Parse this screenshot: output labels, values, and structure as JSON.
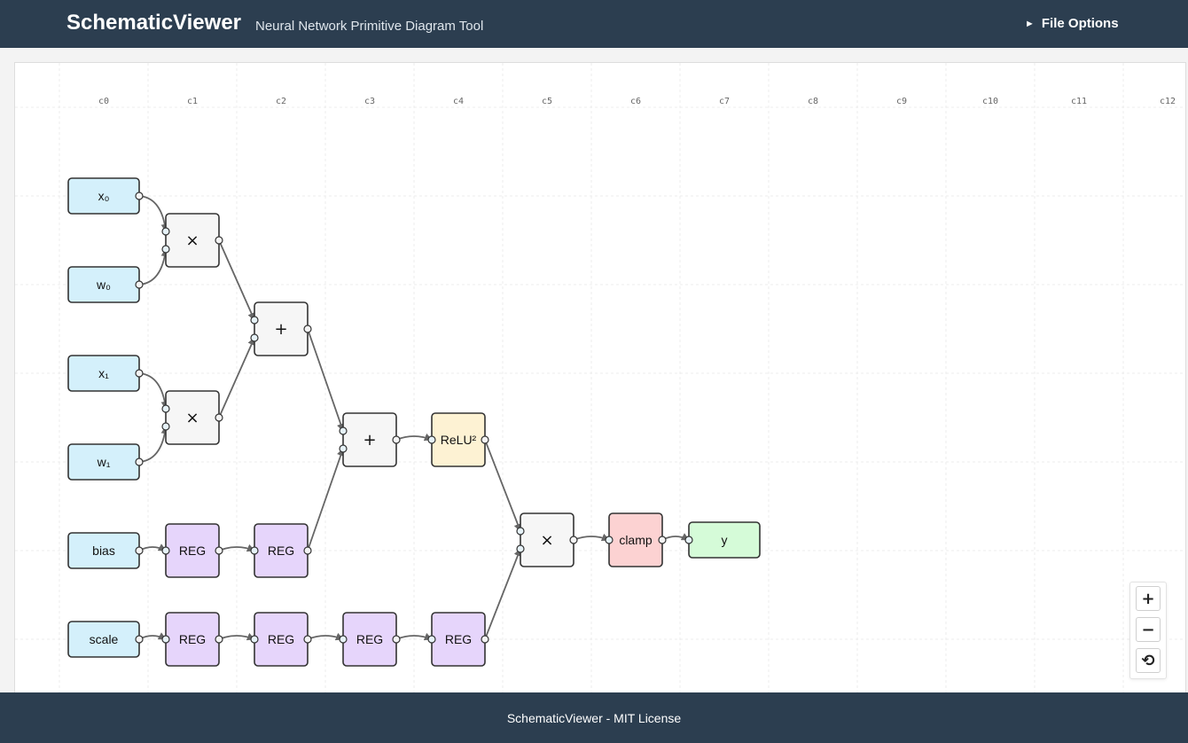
{
  "header": {
    "title": "SchematicViewer",
    "subtitle": "Neural Network Primitive Diagram Tool",
    "file_options": "File Options"
  },
  "columns": [
    "c0",
    "c1",
    "c2",
    "c3",
    "c4",
    "c5",
    "c6",
    "c7",
    "c8",
    "c9",
    "c10",
    "c11",
    "c12"
  ],
  "nodes": [
    {
      "id": "x0",
      "label": "x₀",
      "kind": "input"
    },
    {
      "id": "w0",
      "label": "w₀",
      "kind": "input"
    },
    {
      "id": "x1",
      "label": "x₁",
      "kind": "input"
    },
    {
      "id": "w1",
      "label": "w₁",
      "kind": "input"
    },
    {
      "id": "bias",
      "label": "bias",
      "kind": "input"
    },
    {
      "id": "scale",
      "label": "scale",
      "kind": "input"
    },
    {
      "id": "mul0",
      "label": "×",
      "kind": "op"
    },
    {
      "id": "mul1",
      "label": "×",
      "kind": "op"
    },
    {
      "id": "add0",
      "label": "+",
      "kind": "op"
    },
    {
      "id": "add1",
      "label": "+",
      "kind": "op"
    },
    {
      "id": "relu",
      "label": "ReLU²",
      "kind": "activation"
    },
    {
      "id": "mul2",
      "label": "×",
      "kind": "op"
    },
    {
      "id": "clamp",
      "label": "clamp",
      "kind": "clamp"
    },
    {
      "id": "y",
      "label": "y",
      "kind": "output"
    },
    {
      "id": "regb1",
      "label": "REG",
      "kind": "reg"
    },
    {
      "id": "regb2",
      "label": "REG",
      "kind": "reg"
    },
    {
      "id": "regs1",
      "label": "REG",
      "kind": "reg"
    },
    {
      "id": "regs2",
      "label": "REG",
      "kind": "reg"
    },
    {
      "id": "regs3",
      "label": "REG",
      "kind": "reg"
    },
    {
      "id": "regs4",
      "label": "REG",
      "kind": "reg"
    }
  ],
  "edges": [
    {
      "from": "x0",
      "to": "mul0",
      "port": 0
    },
    {
      "from": "w0",
      "to": "mul0",
      "port": 1
    },
    {
      "from": "x1",
      "to": "mul1",
      "port": 0
    },
    {
      "from": "w1",
      "to": "mul1",
      "port": 1
    },
    {
      "from": "mul0",
      "to": "add0",
      "port": 0
    },
    {
      "from": "mul1",
      "to": "add0",
      "port": 1
    },
    {
      "from": "bias",
      "to": "regb1",
      "port": 0
    },
    {
      "from": "regb1",
      "to": "regb2",
      "port": 0
    },
    {
      "from": "add0",
      "to": "add1",
      "port": 0
    },
    {
      "from": "regb2",
      "to": "add1",
      "port": 1
    },
    {
      "from": "add1",
      "to": "relu",
      "port": 0
    },
    {
      "from": "scale",
      "to": "regs1",
      "port": 0
    },
    {
      "from": "regs1",
      "to": "regs2",
      "port": 0
    },
    {
      "from": "regs2",
      "to": "regs3",
      "port": 0
    },
    {
      "from": "regs3",
      "to": "regs4",
      "port": 0
    },
    {
      "from": "relu",
      "to": "mul2",
      "port": 0
    },
    {
      "from": "regs4",
      "to": "mul2",
      "port": 1
    },
    {
      "from": "mul2",
      "to": "clamp",
      "port": 0
    },
    {
      "from": "clamp",
      "to": "y",
      "port": 0
    }
  ],
  "colors": {
    "input": "#d4f0fb",
    "op": "#f6f6f6",
    "activation": "#fdf2d3",
    "reg": "#e6d5fb",
    "clamp": "#fcd2d2",
    "output": "#d5fbd8",
    "header": "#2c3e50",
    "edge": "#666666"
  },
  "zoom": {
    "in_icon": "+",
    "out_icon": "−",
    "reset_icon": "⟲"
  },
  "footer": {
    "text": "SchematicViewer - MIT License"
  }
}
